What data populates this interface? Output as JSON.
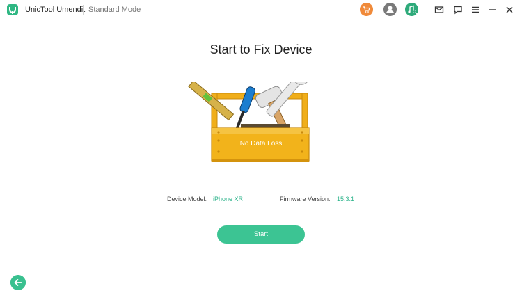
{
  "header": {
    "app_name": "UnicTool Umendit",
    "mode": "Standard Mode"
  },
  "icons": {
    "logo": "umendit-logo-icon",
    "cart": "cart-icon",
    "user": "user-icon",
    "music": "music-search-icon",
    "mail": "mail-icon",
    "chat": "chat-icon",
    "menu": "menu-icon",
    "minimize": "minimize-icon",
    "close": "close-icon",
    "back": "back-arrow-icon"
  },
  "main": {
    "title": "Start to Fix Device",
    "toolbox_label": "No Data Loss",
    "device_model_label": "Device Model:",
    "device_model_value": "iPhone XR",
    "firmware_label": "Firmware Version:",
    "firmware_value": "15.3.1",
    "start_label": "Start"
  },
  "colors": {
    "accent": "#3cc493",
    "value_text": "#2bb38a",
    "cart": "#f08a3a",
    "toolbox": "#f2b31b"
  }
}
